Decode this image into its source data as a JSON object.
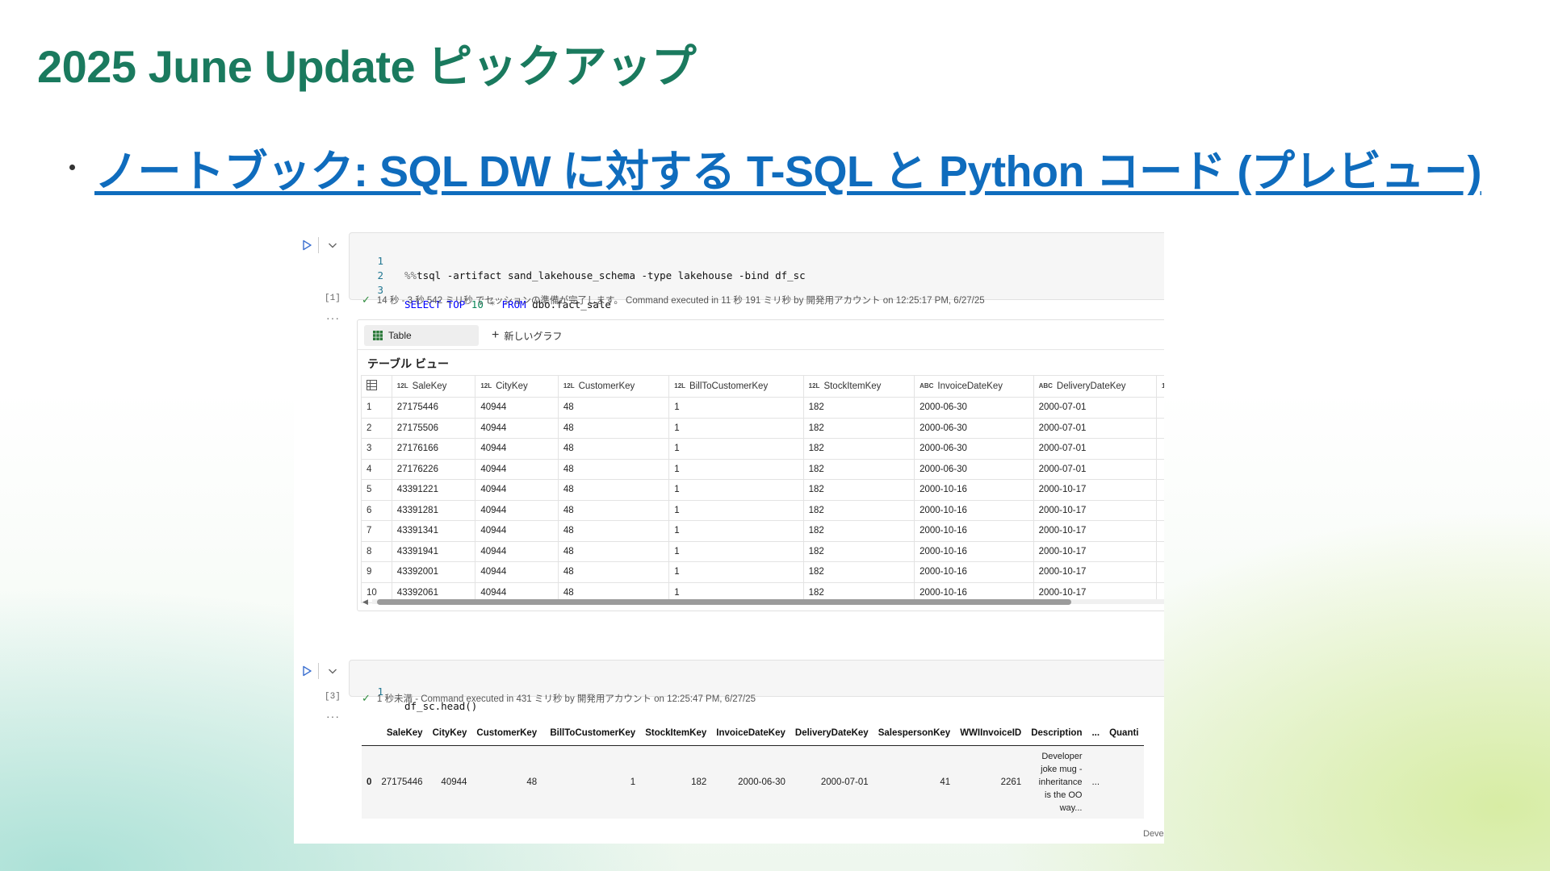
{
  "slide": {
    "title": "2025 June Update ピックアップ",
    "bullet_link": "ノートブック: SQL DW に対する T-SQL と Python コード (プレビュー)"
  },
  "cell1": {
    "exec_count": "[1]",
    "lines": [
      {
        "n": "1",
        "magic": "%%",
        "text": "tsql -artifact sand_lakehouse_schema -type lakehouse -bind df_sc"
      },
      {
        "n": "2"
      },
      {
        "n": "3",
        "kw1": "SELECT TOP",
        "num": "10",
        "star": "*",
        "kw2": "FROM",
        "rest": "dbo.fact_sale"
      }
    ],
    "status": "14 秒 - 3 秒 542 ミリ秒 でセッションの準備が完了します。 Command executed in 11 秒 191 ミリ秒 by 開発用アカウント on 12:25:17 PM, 6/27/25"
  },
  "output1": {
    "tab_table": "Table",
    "tab_new_chart": "新しいグラフ",
    "table_title": "テーブル ビュー",
    "columns": [
      {
        "type": "12L",
        "name": "SaleKey"
      },
      {
        "type": "12L",
        "name": "CityKey"
      },
      {
        "type": "12L",
        "name": "CustomerKey"
      },
      {
        "type": "12L",
        "name": "BillToCustomerKey"
      },
      {
        "type": "12L",
        "name": "StockItemKey"
      },
      {
        "type": "ABC",
        "name": "InvoiceDateKey"
      },
      {
        "type": "ABC",
        "name": "DeliveryDateKey"
      },
      {
        "type": "1",
        "name": ""
      }
    ],
    "rows": [
      [
        "1",
        "27175446",
        "40944",
        "48",
        "1",
        "182",
        "2000-06-30",
        "2000-07-01"
      ],
      [
        "2",
        "27175506",
        "40944",
        "48",
        "1",
        "182",
        "2000-06-30",
        "2000-07-01"
      ],
      [
        "3",
        "27176166",
        "40944",
        "48",
        "1",
        "182",
        "2000-06-30",
        "2000-07-01"
      ],
      [
        "4",
        "27176226",
        "40944",
        "48",
        "1",
        "182",
        "2000-06-30",
        "2000-07-01"
      ],
      [
        "5",
        "43391221",
        "40944",
        "48",
        "1",
        "182",
        "2000-10-16",
        "2000-10-17"
      ],
      [
        "6",
        "43391281",
        "40944",
        "48",
        "1",
        "182",
        "2000-10-16",
        "2000-10-17"
      ],
      [
        "7",
        "43391341",
        "40944",
        "48",
        "1",
        "182",
        "2000-10-16",
        "2000-10-17"
      ],
      [
        "8",
        "43391941",
        "40944",
        "48",
        "1",
        "182",
        "2000-10-16",
        "2000-10-17"
      ],
      [
        "9",
        "43392001",
        "40944",
        "48",
        "1",
        "182",
        "2000-10-16",
        "2000-10-17"
      ],
      [
        "10",
        "43392061",
        "40944",
        "48",
        "1",
        "182",
        "2000-10-16",
        "2000-10-17"
      ]
    ]
  },
  "cell2": {
    "exec_count": "[3]",
    "line_no": "1",
    "code": "df_sc.head()",
    "status": "1 秒未満 - Command executed in 431 ミリ秒 by 開発用アカウント on 12:25:47 PM, 6/27/25"
  },
  "output2": {
    "columns": [
      "SaleKey",
      "CityKey",
      "CustomerKey",
      "BillToCustomerKey",
      "StockItemKey",
      "InvoiceDateKey",
      "DeliveryDateKey",
      "SalespersonKey",
      "WWIInvoiceID",
      "Description",
      "...",
      "Quanti"
    ],
    "row": {
      "index": "0",
      "values": [
        "27175446",
        "40944",
        "48",
        "1",
        "182",
        "2000-06-30",
        "2000-07-01",
        "41",
        "2261"
      ],
      "description": "Developer joke mug - inheritance is the OO way...",
      "ellipsis": "...",
      "next_desc_fragment": "Developer"
    }
  },
  "colors": {
    "title": "#1a7a5e",
    "link": "#0f6cbd",
    "success": "#2e8b3d"
  }
}
